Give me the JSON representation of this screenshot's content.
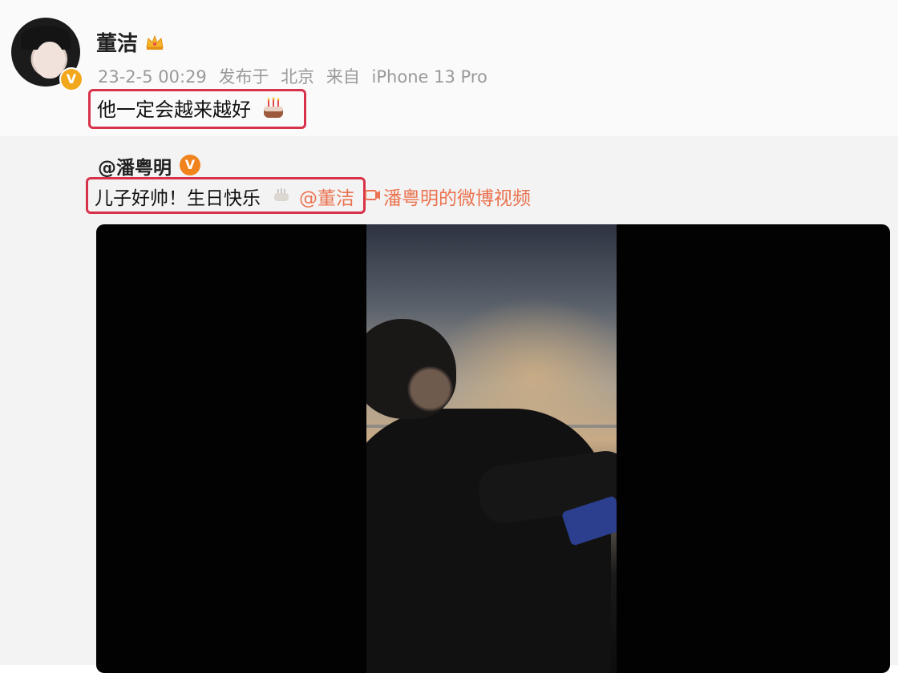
{
  "post": {
    "username": "董洁",
    "timestamp": "23-2-5 00:29",
    "posted_label": "发布于",
    "location": "北京",
    "source_label": "来自",
    "device": "iPhone 13 Pro",
    "text": "他一定会越来越好"
  },
  "repost": {
    "username": "@潘粤明",
    "text": "儿子好帅！生日快乐",
    "mention": "@董洁",
    "video_link": "潘粤明的微博视频"
  },
  "icons": {
    "crown": "crown-icon",
    "cake": "birthday-cake-icon",
    "verified": "verified-badge-icon",
    "video": "video-icon"
  },
  "colors": {
    "highlight": "#d7324a",
    "link": "#eb7350",
    "meta": "#9a9a9a",
    "verified": "#f2a81d",
    "vip": "#f0831c"
  }
}
